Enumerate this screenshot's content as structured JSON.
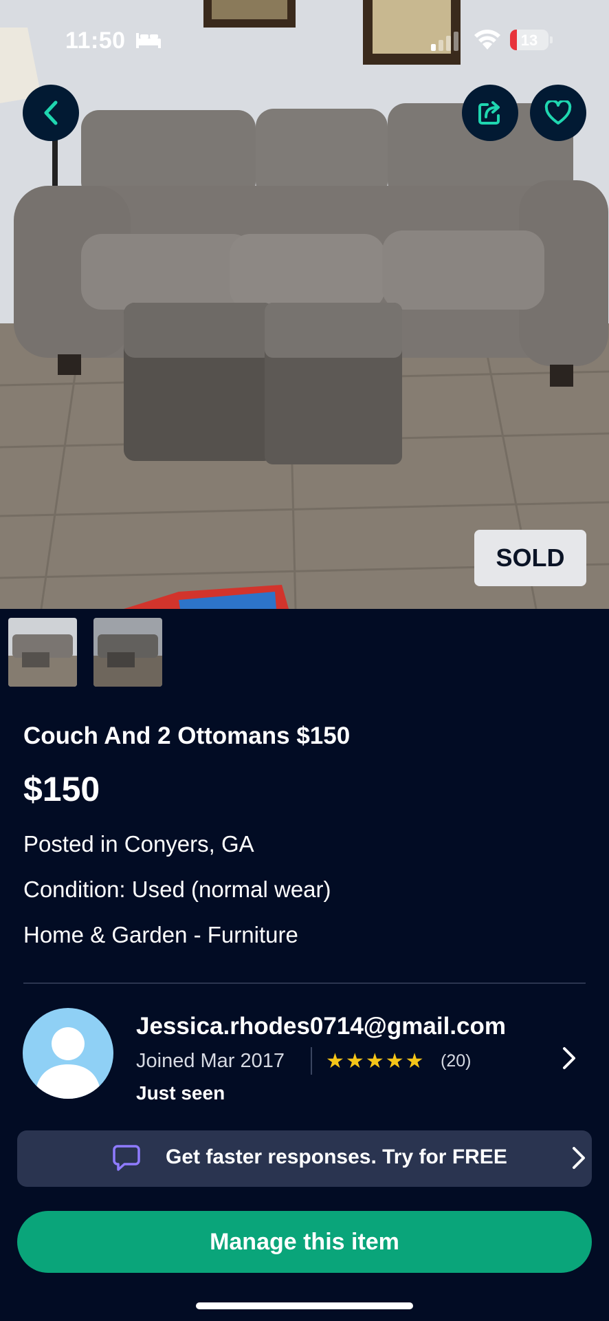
{
  "status_bar": {
    "time": "11:50",
    "battery": "13"
  },
  "photo": {
    "sold_label": "SOLD"
  },
  "listing": {
    "title": "Couch And 2 Ottomans $150",
    "price": "$150",
    "location": "Posted in Conyers, GA",
    "condition": "Condition: Used (normal wear)",
    "category": "Home & Garden - Furniture"
  },
  "seller": {
    "name": "Jessica.rhodes0714@gmail.com",
    "joined": "Joined Mar 2017",
    "rating_stars": 5,
    "review_count": "(20)",
    "status": "Just seen"
  },
  "promo": {
    "text": "Get faster responses.  Try for FREE"
  },
  "actions": {
    "manage_label": "Manage this item"
  },
  "colors": {
    "background": "#020c24",
    "accent_green": "#0aa57a",
    "teal_icon": "#1fd6b0",
    "star": "#f5c518"
  }
}
